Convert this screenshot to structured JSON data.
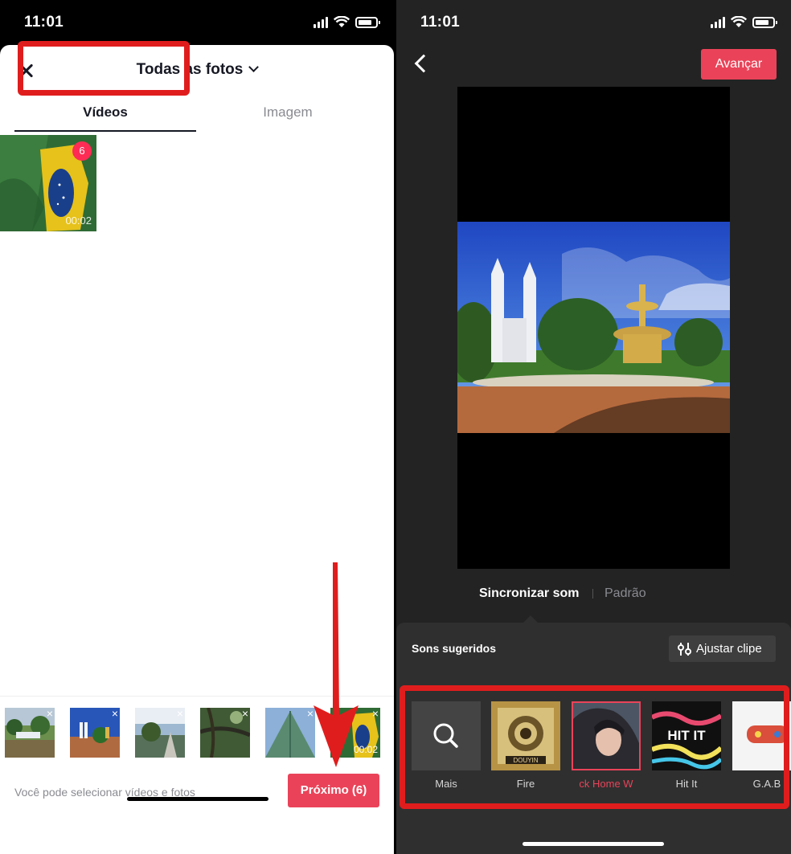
{
  "status_bar": {
    "time_left": "11:01",
    "time_right": "11:01"
  },
  "picker": {
    "album_title": "Todas as fotos",
    "tabs": [
      {
        "label": "Vídeos",
        "active": true
      },
      {
        "label": "Imagem",
        "active": false
      }
    ],
    "main_item": {
      "badge": "6",
      "duration": "00:02"
    },
    "selected_items": [
      {
        "subject": "garden-waterfall",
        "remove": "×"
      },
      {
        "subject": "church-fountain",
        "remove": "×"
      },
      {
        "subject": "river-tree",
        "remove": "×"
      },
      {
        "subject": "tree-branches",
        "remove": "×"
      },
      {
        "subject": "church-spire",
        "remove": "×"
      },
      {
        "subject": "brazil-flag",
        "remove": "×",
        "duration": "00:02"
      }
    ],
    "hint": "Você pode selecionar vídeos e fotos",
    "next_button": "Próximo (6)"
  },
  "editor": {
    "next_button": "Avançar",
    "modes": {
      "sync": "Sincronizar som",
      "default": "Padrão"
    },
    "suggested_title": "Sons sugeridos",
    "adjust_button": "Ajustar clipe",
    "sounds": [
      {
        "label": "Mais"
      },
      {
        "label": "Fire",
        "art_text": "DOUYIN"
      },
      {
        "label": "ck Home  W",
        "selected": true
      },
      {
        "label": "Hit It",
        "art_text": "HIT IT"
      },
      {
        "label": "G.A.B"
      }
    ]
  },
  "colors": {
    "accent": "#ea4359",
    "annotation_red": "#e01d1d",
    "badge": "#fe2c55",
    "dark_bg": "#232323"
  }
}
